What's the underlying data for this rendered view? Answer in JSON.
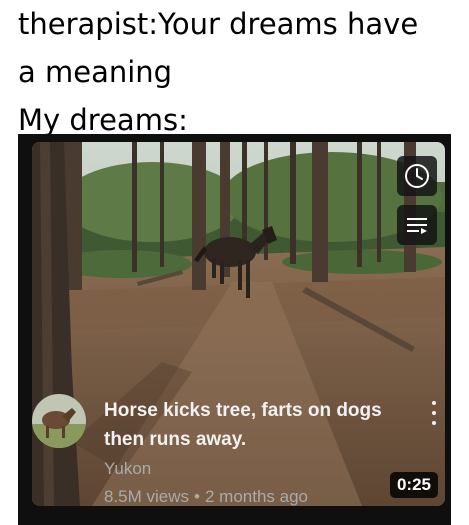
{
  "caption": {
    "line1": "therapist:Your dreams have",
    "line2": "a meaning",
    "line3": "My dreams:"
  },
  "video": {
    "duration": "0:25",
    "title_line1": "Horse kicks tree, farts on dogs",
    "title_line2": "then runs away.",
    "channel": "Yukon",
    "views": "8.5M views",
    "separator": "•",
    "age": "2 months ago"
  },
  "icons": {
    "watch_later": "clock-icon",
    "add_to_queue": "queue-icon",
    "more": "kebab-menu-icon"
  },
  "colors": {
    "card_background": "#0f0f0f",
    "title_text": "#f1f1f1",
    "secondary_text": "#aaaaaa"
  }
}
